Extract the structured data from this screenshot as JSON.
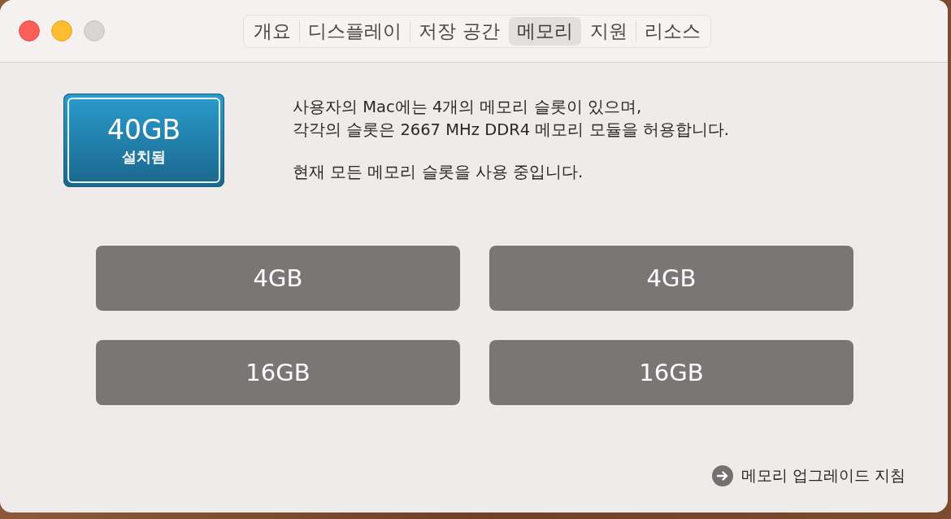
{
  "window": {
    "buttons": [
      {
        "kind": "close",
        "disabled": false
      },
      {
        "kind": "minimize",
        "disabled": false
      },
      {
        "kind": "zoom",
        "disabled": true
      }
    ]
  },
  "tabs": [
    {
      "label": "개요",
      "selected": false
    },
    {
      "label": "디스플레이",
      "selected": false
    },
    {
      "label": "저장 공간",
      "selected": false
    },
    {
      "label": "메모리",
      "selected": true
    },
    {
      "label": "지원",
      "selected": false
    },
    {
      "label": "리소스",
      "selected": false
    }
  ],
  "memory_total": {
    "amount": "40GB",
    "caption": "설치됨"
  },
  "description": [
    "사용자의 Mac에는 4개의 메모리 슬롯이 있으며,\n각각의 슬롯은 2667 MHz DDR4 메모리 모듈을 허용합니다.",
    "현재 모든 메모리 슬롯을 사용 중입니다."
  ],
  "slots": [
    {
      "size": "4GB"
    },
    {
      "size": "4GB"
    },
    {
      "size": "16GB"
    },
    {
      "size": "16GB"
    }
  ],
  "link": {
    "label": "메모리 업그레이드 지침"
  }
}
